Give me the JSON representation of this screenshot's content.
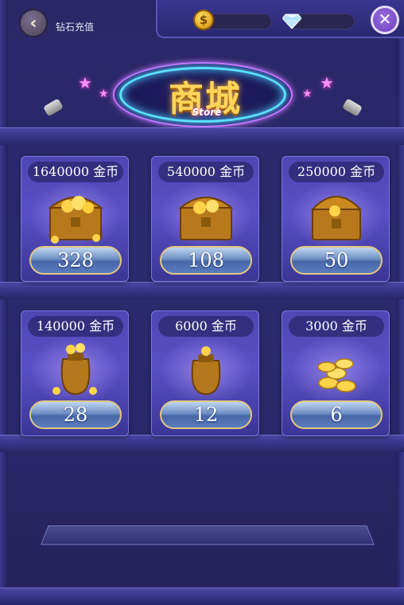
{
  "header": {
    "back_label": "钻石充值",
    "coin_symbol": "$"
  },
  "banner": {
    "title": "商城",
    "subtitle": "Store"
  },
  "items": [
    {
      "label": "1640000 金币",
      "price": "328",
      "art": "treasure-chest"
    },
    {
      "label": "540000 金币",
      "price": "108",
      "art": "treasure-chest"
    },
    {
      "label": "250000 金币",
      "price": "50",
      "art": "treasure-chest"
    },
    {
      "label": "140000 金币",
      "price": "28",
      "art": "coin-sack"
    },
    {
      "label": "6000 金币",
      "price": "12",
      "art": "coin-sack"
    },
    {
      "label": "3000 金币",
      "price": "6",
      "art": "coin-pile"
    }
  ],
  "colors": {
    "accent_gold": "#ffd65a",
    "neon_blue": "#5be1ff",
    "neon_pink": "#d86bff",
    "card_purple": "#5a4fc6"
  }
}
